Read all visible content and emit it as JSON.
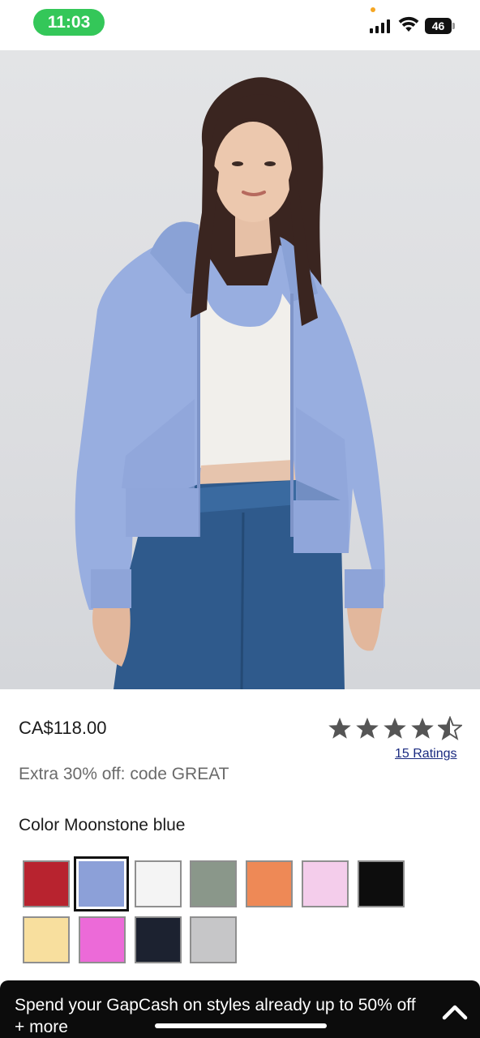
{
  "status_bar": {
    "time": "11:03",
    "battery": "46",
    "time_pill_color": "#34c759"
  },
  "hero": {
    "image_description_icon": "product-photo",
    "dots_count": 5,
    "active_dot_index": 0
  },
  "product": {
    "price": "CA$118.00",
    "rating": 4.5,
    "rating_max": 5,
    "ratings_link": "15 Ratings",
    "promo": "Extra 30% off: code GREAT",
    "color_prefix": "Color",
    "color_name": "Moonstone blue"
  },
  "swatches": [
    {
      "name": "red",
      "color": "#b8232f",
      "selected": false
    },
    {
      "name": "moonstone-blue",
      "color": "#8ca0d8",
      "selected": true
    },
    {
      "name": "white",
      "color": "#f4f4f4",
      "selected": false
    },
    {
      "name": "sage-green",
      "color": "#8a978a",
      "selected": false
    },
    {
      "name": "orange",
      "color": "#ee8956",
      "selected": false
    },
    {
      "name": "light-pink",
      "color": "#f4cdeb",
      "selected": false
    },
    {
      "name": "black",
      "color": "#0d0d0d",
      "selected": false
    },
    {
      "name": "yellow",
      "color": "#f8df9e",
      "selected": false
    },
    {
      "name": "pink",
      "color": "#ec6ad8",
      "selected": false
    },
    {
      "name": "navy",
      "color": "#1c2230",
      "selected": false
    },
    {
      "name": "heather-grey",
      "color": "#c6c6c8",
      "selected": false
    }
  ],
  "banner": {
    "text": "Spend your GapCash on styles already up to 50% off + more",
    "icon": "chevron-up-icon"
  },
  "colors": {
    "link": "#1a2a80",
    "star": "#555555",
    "banner_bg": "#0c0c0c"
  }
}
